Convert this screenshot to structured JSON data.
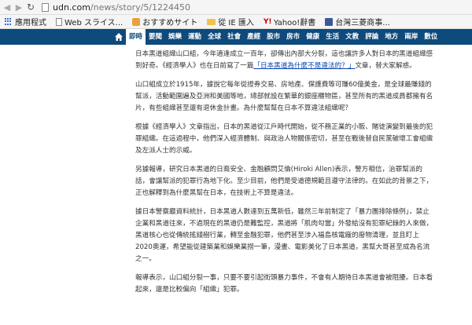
{
  "browser": {
    "url_domain": "udn.com",
    "url_path": "/news/story/5/1224450",
    "bookmarks": [
      {
        "label": "應用程式",
        "icon": "apps-grid-icon"
      },
      {
        "label": "Web スライス...",
        "icon": "document-icon"
      },
      {
        "label": "おすすめサイト",
        "icon": "site-icon"
      },
      {
        "label": "從 IE 匯入",
        "icon": "folder-icon"
      },
      {
        "label": "Yahoo!辭書",
        "icon": "yahoo-icon"
      },
      {
        "label": "台灣三菱商事...",
        "icon": "favicon-icon"
      }
    ]
  },
  "site_nav": {
    "items": [
      "即時",
      "要聞",
      "娛樂",
      "運動",
      "全球",
      "社會",
      "產經",
      "股市",
      "房市",
      "健康",
      "生活",
      "文教",
      "評論",
      "地方",
      "兩岸",
      "數位"
    ],
    "active": "即時",
    "bg_color": "#0e4a7c"
  },
  "article": {
    "p1_before_link": "日本黑道組織山口組，今年適逢成立一百年，卻傳出內部大分裂，這也讓許多人對日本的黑道組織感到好奇。《經濟學人》也在日前寫了一篇",
    "p1_link": "「日本黑道為什麼不是違法的？」",
    "p1_after_link": "文章，替大家解惑。",
    "p2": "山口組成立於1915年，據說它每年從證券交易、房地產、保護費等可賺60億美金，是全球最賺錢的幫派，活動範圍遍及亞洲和美國等地，總部就設在繁華的銀座櫃物區，甚至所有的黑道成員都擁有名片，有些組織甚至還有退休金計畫。為什麼幫幫在日本不算違法組織呢？",
    "p3": "根據《經濟學人》文章指出，日本的黑道從江戶時代開始，從不務正業的小販、賭徒演變到最後的犯罪組織。在這過程中，他們深入經濟體制、與政治人物關係密切，甚至在戰後替自民黨破壞工會組織及左派人士的示威。",
    "p4": "另據報導，研究日本黑道的日裔安全、金融顧問艾倫(Hiroki Allen)表示，警方相信，治罪幫派的話，會讓幫派的犯罪行為地下化。至少目前，他們是受道德規範且遵守法律的。在如此的背景之下，正也解釋到為什麼黑幫在日本，在技術上不算是違法。",
    "p5": "據日本警察廳資料統計，日本黑道人數達到五萬新低，雖然三年前制定了「暴力團排除條例」，禁止企業和黑道往來，不過現在的黑道仍是難監控，黑道將「肌肉勾當」外發給沒有犯罪紀錄的人來做，黑道核心也從傳統搖錢樹行業，轉至金融犯罪，他們甚至涉入福島核電廠的廢物清理，並且盯上2020奧運，希望能從建築業和娛樂業撈一筆，漫畫、電影美化了日本黑道，黑幫大哥甚至成為名流之一。",
    "p6": "報導表示，山口組分裂一事，只要不要引起街頭暴力事件，不會有人期待日本黑道會被阻擾。日本看起來，還是比較偏向「組織」犯罪。"
  }
}
